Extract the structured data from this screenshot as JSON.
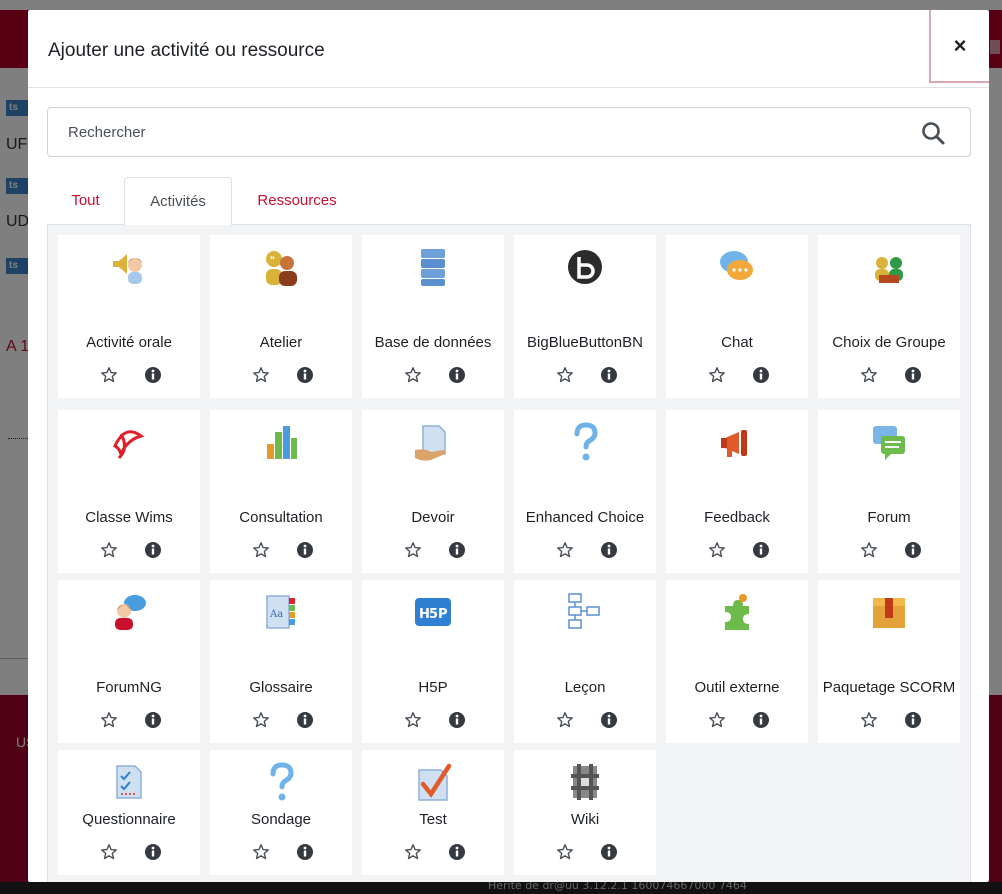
{
  "modal": {
    "title": "Ajouter une activité ou ressource",
    "close_label": "×"
  },
  "search": {
    "placeholder": "Rechercher"
  },
  "tabs": [
    {
      "label": "Tout"
    },
    {
      "label": "Activités",
      "active": true
    },
    {
      "label": "Ressources"
    }
  ],
  "activities": [
    {
      "name": "Activité orale",
      "icon": "speaker-person-icon"
    },
    {
      "name": "Atelier",
      "icon": "workshop-people-icon"
    },
    {
      "name": "Base de données",
      "icon": "database-icon"
    },
    {
      "name": "BigBlueButtonBN",
      "icon": "bigbluebutton-icon"
    },
    {
      "name": "Chat",
      "icon": "chat-bubbles-icon"
    },
    {
      "name": "Choix de Groupe",
      "icon": "group-choice-icon"
    },
    {
      "name": "Classe Wims",
      "icon": "wims-icon"
    },
    {
      "name": "Consultation",
      "icon": "bar-chart-icon"
    },
    {
      "name": "Devoir",
      "icon": "assignment-icon"
    },
    {
      "name": "Enhanced Choice",
      "icon": "question-mark-icon"
    },
    {
      "name": "Feedback",
      "icon": "megaphone-icon"
    },
    {
      "name": "Forum",
      "icon": "forum-bubbles-icon"
    },
    {
      "name": "ForumNG",
      "icon": "forumng-icon"
    },
    {
      "name": "Glossaire",
      "icon": "glossary-book-icon"
    },
    {
      "name": "H5P",
      "icon": "h5p-icon"
    },
    {
      "name": "Leçon",
      "icon": "lesson-flow-icon"
    },
    {
      "name": "Outil externe",
      "icon": "puzzle-icon"
    },
    {
      "name": "Paquetage SCORM",
      "icon": "scorm-package-icon"
    },
    {
      "name": "Questionnaire",
      "icon": "questionnaire-icon"
    },
    {
      "name": "Sondage",
      "icon": "survey-question-icon"
    },
    {
      "name": "Test",
      "icon": "quiz-check-icon"
    },
    {
      "name": "Wiki",
      "icon": "wiki-icon"
    }
  ],
  "card_actions": {
    "star_icon": "star-outline-icon",
    "info_icon": "info-circle-icon"
  },
  "background": {
    "badge_text": "ts",
    "footer_text": "USC",
    "bottom_text": "Hérite de dr@uu 3.12.2.1 160074667000 7464"
  },
  "colors": {
    "accent": "#c8102e",
    "brand_topbar": "#b5002b",
    "panel_bg": "#f1f3f5"
  }
}
